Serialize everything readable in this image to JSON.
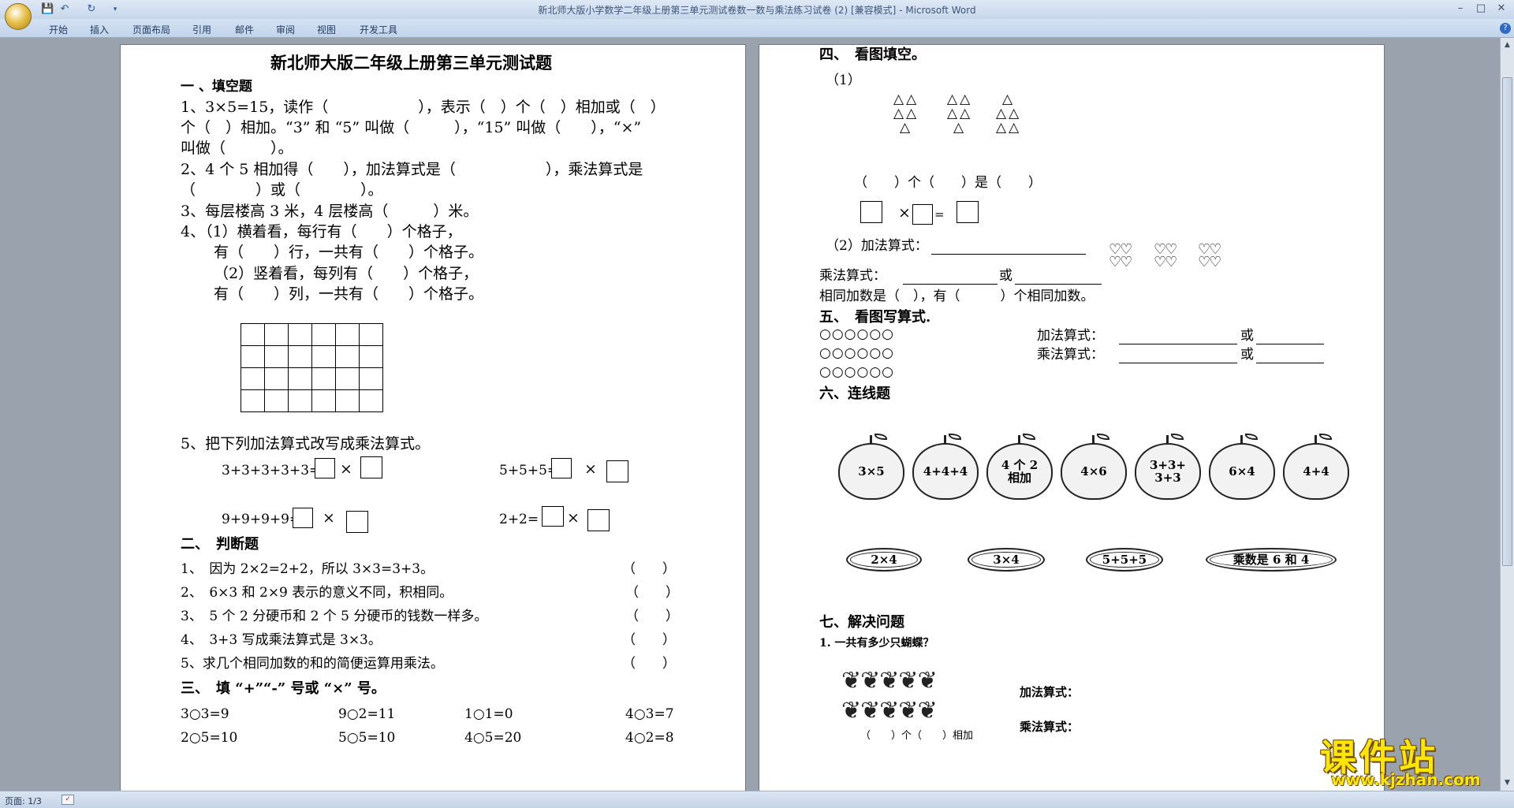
{
  "window": {
    "title": "新北师大版小学数学二年级上册第三单元测试卷数一数与乘法练习试卷 (2) [兼容模式]",
    "app_name": " - Microsoft Word"
  },
  "quick_access": {
    "save": "💾",
    "undo": "↶",
    "redo": "↻",
    "more": "▾"
  },
  "window_controls": {
    "minimize": "–",
    "maximize": "□",
    "close": "✕"
  },
  "ribbon": {
    "tabs": [
      "开始",
      "插入",
      "页面布局",
      "引用",
      "邮件",
      "审阅",
      "视图",
      "开发工具"
    ],
    "help": "?"
  },
  "page1": {
    "title": "新北师大版二年级上册第三单元测试题",
    "s1_heading": "一 、填空题",
    "q1_l1": "1、3×5=15，读作（　　　　　　），表示（　）个（　）相加或（　）",
    "q1_l2": "个（　）相加。“3” 和 “5” 叫做（　　　），“15” 叫做（　　），“×”",
    "q1_l3": "叫做（　　　）。",
    "q2_l1": "2、4 个 5 相加得（　　），加法算式是（　　　　　　），乘法算式是",
    "q2_l2": "（　　　　）或（　　　　）。",
    "q3": "3、每层楼高 3 米，4 层楼高（　　　）米。",
    "q4_l1": "4、（1）横着看，每行有（　　）个格子，",
    "q4_l2": "有（　　）行，一共有（　　）个格子。",
    "q4_l3": "（2）竖着看，每列有（　　）个格子，",
    "q4_l4": "有（　　）列，一共有（　　）个格子。",
    "q5": "5、把下列加法算式改写成乘法算式。",
    "q5_a": "3+3+3+3+3=",
    "q5_b": "5+5+5=",
    "q5_c": "9+9+9+9=",
    "q5_d": "2+2=",
    "times": "×",
    "s2_heading": "二、　判断题",
    "judge": [
      {
        "text": "1、　因为 2×2=2+2，所以 3×3=3+3。",
        "paren": "（　　）"
      },
      {
        "text": "2、　6×3 和 2×9 表示的意义不同，积相同。",
        "paren": "（　　）"
      },
      {
        "text": "3、　5 个 2 分硬币和 2 个 5 分硬币的钱数一样多。",
        "paren": "（　　）"
      },
      {
        "text": "4、　3+3 写成乘法算式是 3×3。",
        "paren": "（　　）"
      },
      {
        "text": "5、求几个相同加数的和的简便运算用乘法。",
        "paren": "（　　）"
      }
    ],
    "s3_heading": "三、　填 “+”“-” 号或 “×” 号。",
    "fill_row1": [
      "3○3=9",
      "9○2=11",
      "1○1=0",
      "4○3=7"
    ],
    "fill_row2": [
      "2○5=10",
      "5○5=10",
      "4○5=20",
      "4○2=8"
    ]
  },
  "page2": {
    "s4_heading": "四、　看图填空。",
    "s4_p1": "（1）",
    "s4_triangles": "△△",
    "s4_fill1": "（　　）个（　　）是（　　）",
    "s4_eq": "=",
    "s4_p2": "（2）加法算式：",
    "s4_hearts": "♡♡",
    "s4_mul": "乘法算式：",
    "s4_or": "或",
    "s4_same": "相同加数是（　），有（　　　）个相同加数。",
    "s5_heading": "五、　看图写算式.",
    "s5_circles": "○○○○○○",
    "s5_add": "加法算式：",
    "s5_mul": "乘法算式：",
    "s6_heading": "六、连线题",
    "apples": [
      "3×5",
      "4+4+4",
      "4 个 2 相加",
      "4×6",
      "3+3+ 3+3",
      "6×4",
      "4+4"
    ],
    "plates": [
      "2×4",
      "3×4",
      "5+5+5",
      "乘数是 6 和 4"
    ],
    "s7_heading": "七、解决问题",
    "s7_q1": "1. 一共有多少只蝴蝶？",
    "s7_add": "加法算式：",
    "s7_mul": "乘法算式：",
    "s7_caption": "（　　）个（　　）相加",
    "butterfly": "❦"
  },
  "status": {
    "page": "页面: 1/3"
  },
  "watermark": {
    "main": "课件站",
    "url": "www.kjzhan.com"
  }
}
